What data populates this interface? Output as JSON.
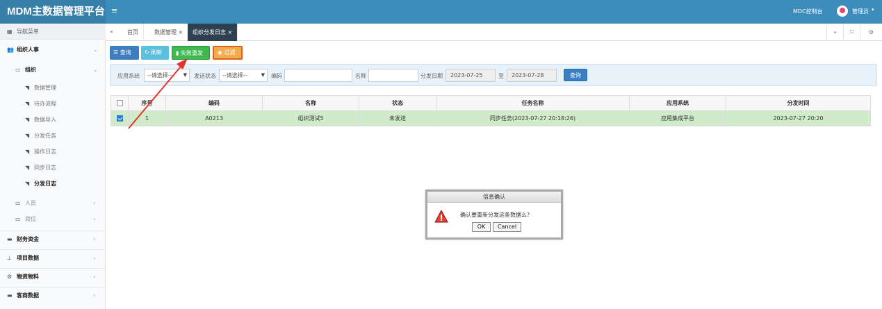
{
  "header": {
    "brand": "MDM主数据管理平台",
    "menu_toggle": "≡",
    "mdc_link": "MDC控制台",
    "user_name": "管理员",
    "user_caret": "▾"
  },
  "sidebar": {
    "nav_title": "导航菜单",
    "groups": [
      {
        "label": "组织人事",
        "icon": "users-icon"
      },
      {
        "label": "组织",
        "icon": "folder-icon"
      }
    ],
    "leaves": [
      {
        "label": "数据管理"
      },
      {
        "label": "待办流程"
      },
      {
        "label": "数据导入"
      },
      {
        "label": "分发任务"
      },
      {
        "label": "操作日志"
      },
      {
        "label": "同步日志"
      },
      {
        "label": "分发日志"
      }
    ],
    "folders": [
      {
        "label": "人员"
      },
      {
        "label": "岗位"
      }
    ],
    "modules": [
      {
        "label": "财务资金",
        "icon": "card-icon"
      },
      {
        "label": "项目数据",
        "icon": "sitemap-icon"
      },
      {
        "label": "物资物料",
        "icon": "cubes-icon"
      },
      {
        "label": "客商数据",
        "icon": "briefcase-icon"
      }
    ]
  },
  "tabs": {
    "items": [
      {
        "label": "首页"
      },
      {
        "label": "数据管理 ×"
      },
      {
        "label": "组织分发日志 ×"
      }
    ]
  },
  "toolbar": {
    "query": "查询",
    "refresh": "刷新",
    "resend": "失败重发",
    "filter": "过滤"
  },
  "filters": {
    "app_system_label": "应用系统",
    "app_system_value": "--请选择--",
    "send_status_label": "发送状态",
    "send_status_value": "--请选择--",
    "code_label": "编码",
    "code_value": "",
    "name_label": "名称",
    "name_value": "",
    "date_label": "分发日期",
    "date_from": "2023-07-25",
    "date_sep": "至",
    "date_to": "2023-07-28",
    "search_button": "查询"
  },
  "table": {
    "headers": [
      "",
      "序号",
      "编码",
      "名称",
      "状态",
      "任务名称",
      "应用系统",
      "分发时间"
    ],
    "rows": [
      {
        "index": "1",
        "code": "A0213",
        "name": "组织测试5",
        "status": "未发送",
        "task": "同步任务(2023-07-27 20:18:26)",
        "app": "应用集成平台",
        "time": "2023-07-27 20:20"
      }
    ]
  },
  "dialog": {
    "title": "信息确认",
    "message": "确认要重新分发这条数据么?",
    "ok": "OK",
    "cancel": "Cancel"
  },
  "colors": {
    "header_bg": "#3c8dbc",
    "selected_row": "#d0ebc9",
    "highlight_arrow": "#e0342c"
  }
}
